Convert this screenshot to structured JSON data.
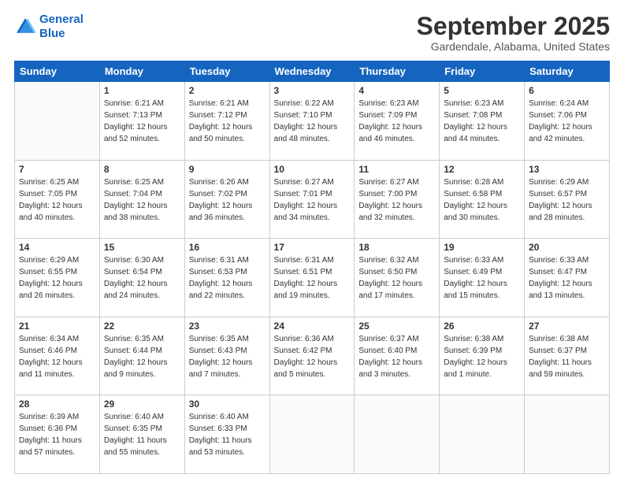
{
  "logo": {
    "line1": "General",
    "line2": "Blue"
  },
  "title": "September 2025",
  "location": "Gardendale, Alabama, United States",
  "days_of_week": [
    "Sunday",
    "Monday",
    "Tuesday",
    "Wednesday",
    "Thursday",
    "Friday",
    "Saturday"
  ],
  "weeks": [
    [
      {
        "day": "",
        "info": ""
      },
      {
        "day": "1",
        "info": "Sunrise: 6:21 AM\nSunset: 7:13 PM\nDaylight: 12 hours\nand 52 minutes."
      },
      {
        "day": "2",
        "info": "Sunrise: 6:21 AM\nSunset: 7:12 PM\nDaylight: 12 hours\nand 50 minutes."
      },
      {
        "day": "3",
        "info": "Sunrise: 6:22 AM\nSunset: 7:10 PM\nDaylight: 12 hours\nand 48 minutes."
      },
      {
        "day": "4",
        "info": "Sunrise: 6:23 AM\nSunset: 7:09 PM\nDaylight: 12 hours\nand 46 minutes."
      },
      {
        "day": "5",
        "info": "Sunrise: 6:23 AM\nSunset: 7:08 PM\nDaylight: 12 hours\nand 44 minutes."
      },
      {
        "day": "6",
        "info": "Sunrise: 6:24 AM\nSunset: 7:06 PM\nDaylight: 12 hours\nand 42 minutes."
      }
    ],
    [
      {
        "day": "7",
        "info": "Sunrise: 6:25 AM\nSunset: 7:05 PM\nDaylight: 12 hours\nand 40 minutes."
      },
      {
        "day": "8",
        "info": "Sunrise: 6:25 AM\nSunset: 7:04 PM\nDaylight: 12 hours\nand 38 minutes."
      },
      {
        "day": "9",
        "info": "Sunrise: 6:26 AM\nSunset: 7:02 PM\nDaylight: 12 hours\nand 36 minutes."
      },
      {
        "day": "10",
        "info": "Sunrise: 6:27 AM\nSunset: 7:01 PM\nDaylight: 12 hours\nand 34 minutes."
      },
      {
        "day": "11",
        "info": "Sunrise: 6:27 AM\nSunset: 7:00 PM\nDaylight: 12 hours\nand 32 minutes."
      },
      {
        "day": "12",
        "info": "Sunrise: 6:28 AM\nSunset: 6:58 PM\nDaylight: 12 hours\nand 30 minutes."
      },
      {
        "day": "13",
        "info": "Sunrise: 6:29 AM\nSunset: 6:57 PM\nDaylight: 12 hours\nand 28 minutes."
      }
    ],
    [
      {
        "day": "14",
        "info": "Sunrise: 6:29 AM\nSunset: 6:55 PM\nDaylight: 12 hours\nand 26 minutes."
      },
      {
        "day": "15",
        "info": "Sunrise: 6:30 AM\nSunset: 6:54 PM\nDaylight: 12 hours\nand 24 minutes."
      },
      {
        "day": "16",
        "info": "Sunrise: 6:31 AM\nSunset: 6:53 PM\nDaylight: 12 hours\nand 22 minutes."
      },
      {
        "day": "17",
        "info": "Sunrise: 6:31 AM\nSunset: 6:51 PM\nDaylight: 12 hours\nand 19 minutes."
      },
      {
        "day": "18",
        "info": "Sunrise: 6:32 AM\nSunset: 6:50 PM\nDaylight: 12 hours\nand 17 minutes."
      },
      {
        "day": "19",
        "info": "Sunrise: 6:33 AM\nSunset: 6:49 PM\nDaylight: 12 hours\nand 15 minutes."
      },
      {
        "day": "20",
        "info": "Sunrise: 6:33 AM\nSunset: 6:47 PM\nDaylight: 12 hours\nand 13 minutes."
      }
    ],
    [
      {
        "day": "21",
        "info": "Sunrise: 6:34 AM\nSunset: 6:46 PM\nDaylight: 12 hours\nand 11 minutes."
      },
      {
        "day": "22",
        "info": "Sunrise: 6:35 AM\nSunset: 6:44 PM\nDaylight: 12 hours\nand 9 minutes."
      },
      {
        "day": "23",
        "info": "Sunrise: 6:35 AM\nSunset: 6:43 PM\nDaylight: 12 hours\nand 7 minutes."
      },
      {
        "day": "24",
        "info": "Sunrise: 6:36 AM\nSunset: 6:42 PM\nDaylight: 12 hours\nand 5 minutes."
      },
      {
        "day": "25",
        "info": "Sunrise: 6:37 AM\nSunset: 6:40 PM\nDaylight: 12 hours\nand 3 minutes."
      },
      {
        "day": "26",
        "info": "Sunrise: 6:38 AM\nSunset: 6:39 PM\nDaylight: 12 hours\nand 1 minute."
      },
      {
        "day": "27",
        "info": "Sunrise: 6:38 AM\nSunset: 6:37 PM\nDaylight: 11 hours\nand 59 minutes."
      }
    ],
    [
      {
        "day": "28",
        "info": "Sunrise: 6:39 AM\nSunset: 6:36 PM\nDaylight: 11 hours\nand 57 minutes."
      },
      {
        "day": "29",
        "info": "Sunrise: 6:40 AM\nSunset: 6:35 PM\nDaylight: 11 hours\nand 55 minutes."
      },
      {
        "day": "30",
        "info": "Sunrise: 6:40 AM\nSunset: 6:33 PM\nDaylight: 11 hours\nand 53 minutes."
      },
      {
        "day": "",
        "info": ""
      },
      {
        "day": "",
        "info": ""
      },
      {
        "day": "",
        "info": ""
      },
      {
        "day": "",
        "info": ""
      }
    ]
  ]
}
